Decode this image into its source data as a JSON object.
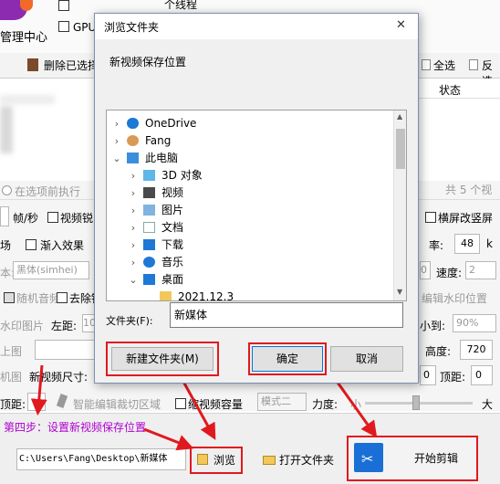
{
  "app": {
    "management_center": "管理中心",
    "threads_suffix": "个线程",
    "gpu_label": "GPU加",
    "toolbar": {
      "delete_selected": "删除已选择",
      "select_all": "全选",
      "invert": "反选"
    },
    "table": {
      "status_header": "状态"
    },
    "summary": "共 5 个视",
    "options": {
      "execute_before_option": "在选项前执行",
      "fps_unit": "帧/秒",
      "video_sharpen": "视频锐",
      "scene": "场",
      "fade_in": "渐入效果",
      "portrait_switch": "横屏改竖屏",
      "rate_label": "率:",
      "rate_value": "48",
      "rate_unit": "k",
      "font_prefix": "本:",
      "font_value": "黑体(simhei)",
      "speed_label": "速度:",
      "speed_value": "2",
      "first_value": "0",
      "random_audio": "随机音频",
      "remove_item": "去除锦",
      "edit_watermark": "编辑水印位置",
      "watermark_image": "水印图片",
      "left_margin_label": "左距:",
      "left_margin_value": "10",
      "shrink_to_label": "小到:",
      "shrink_to_value": "90%",
      "upload_image": "上图",
      "height_label": "高度:",
      "height_value": "720",
      "machine": "机图",
      "new_video_size": "新视频尺寸:",
      "bottom_margin_label": "顶距:",
      "bottom_margin_value": "0",
      "pad_value": "0",
      "top_margin_label": "顶距:",
      "smart_crop": "智能编辑裁切区域",
      "compress_capacity": "缩视频容量",
      "mode_value": "模式二",
      "strength_label": "力度:",
      "strength_small": "小",
      "strength_large": "大"
    },
    "bottom": {
      "step4": "第四步：设置新视频保存位置",
      "path_value": "C:\\Users\\Fang\\Desktop\\新媒体",
      "browse": "浏览",
      "open_folder": "打开文件夹",
      "start_edit": "开始剪辑"
    }
  },
  "dialog": {
    "title": "浏览文件夹",
    "close_glyph": "✕",
    "description": "新视频保存位置",
    "tree": [
      {
        "label": "OneDrive",
        "chevron": "›",
        "icon": "cloud-icon",
        "level": 0
      },
      {
        "label": "Fang",
        "chevron": "›",
        "icon": "user-icon",
        "level": 0
      },
      {
        "label": "此电脑",
        "chevron": "⌄",
        "icon": "computer-icon",
        "level": 0
      },
      {
        "label": "3D 对象",
        "chevron": "›",
        "icon": "cube-icon",
        "level": 1
      },
      {
        "label": "视频",
        "chevron": "›",
        "icon": "video-icon",
        "level": 1
      },
      {
        "label": "图片",
        "chevron": "›",
        "icon": "picture-icon",
        "level": 1
      },
      {
        "label": "文档",
        "chevron": "›",
        "icon": "document-icon",
        "level": 1
      },
      {
        "label": "下载",
        "chevron": "›",
        "icon": "download-icon",
        "level": 1
      },
      {
        "label": "音乐",
        "chevron": "›",
        "icon": "music-icon",
        "level": 1
      },
      {
        "label": "桌面",
        "chevron": "⌄",
        "icon": "desktop-icon",
        "level": 1
      },
      {
        "label": "2021.12.3",
        "chevron": "",
        "icon": "folder-icon",
        "level": 2
      }
    ],
    "folder_label": "文件夹(F):",
    "folder_value": "新媒体",
    "new_folder_button": "新建文件夹(M)",
    "ok_button": "确定",
    "cancel_button": "取消"
  },
  "colors": {
    "accent_red": "#e0191f",
    "selection_blue": "#cce8ff",
    "step_text": "#b000d0"
  }
}
